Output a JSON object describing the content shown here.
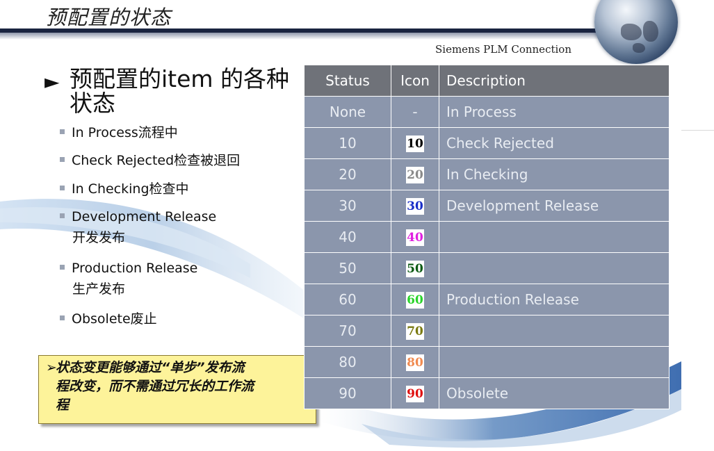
{
  "title": "预配置的状态",
  "brand": "Siemens PLM Connection",
  "heading": "预配置的item 的各种状态",
  "bullets": [
    {
      "line1": "In Process流程中",
      "line2": ""
    },
    {
      "line1": "Check Rejected检查被退回",
      "line2": ""
    },
    {
      "line1": "In Checking检查中",
      "line2": ""
    },
    {
      "line1": "Development Release",
      "line2": "开发发布"
    },
    {
      "line1": "Production Release",
      "line2": "生产发布"
    },
    {
      "line1": "Obsolete废止",
      "line2": ""
    }
  ],
  "note": {
    "line1": "状态变更能够通过“单步”发布流",
    "line2": "程改变，而不需通过冗长的工作流",
    "line3": "程"
  },
  "table": {
    "headers": {
      "status": "Status",
      "icon": "Icon",
      "description": "Description"
    },
    "rows": [
      {
        "status": "None",
        "icon": "-",
        "icon_color": "",
        "description": "In Process"
      },
      {
        "status": "10",
        "icon": "10",
        "icon_color": "#000000",
        "description": "Check Rejected"
      },
      {
        "status": "20",
        "icon": "20",
        "icon_color": "#8a8a8a",
        "description": "In Checking"
      },
      {
        "status": "30",
        "icon": "30",
        "icon_color": "#1a2fc8",
        "description": "Development Release"
      },
      {
        "status": "40",
        "icon": "40",
        "icon_color": "#e020e0",
        "description": ""
      },
      {
        "status": "50",
        "icon": "50",
        "icon_color": "#0b5a12",
        "description": ""
      },
      {
        "status": "60",
        "icon": "60",
        "icon_color": "#2ad42a",
        "description": "Production Release"
      },
      {
        "status": "70",
        "icon": "70",
        "icon_color": "#7a7a10",
        "description": ""
      },
      {
        "status": "80",
        "icon": "80",
        "icon_color": "#f08a50",
        "description": ""
      },
      {
        "status": "90",
        "icon": "90",
        "icon_color": "#e01010",
        "description": "Obsolete"
      }
    ]
  }
}
